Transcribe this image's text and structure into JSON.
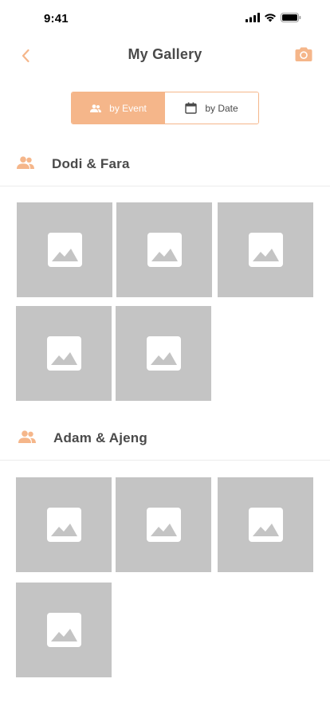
{
  "status": {
    "time": "9:41"
  },
  "header": {
    "title": "My Gallery"
  },
  "toggle": {
    "by_event_label": "by Event",
    "by_date_label": "by Date",
    "active": "by_event"
  },
  "groups": [
    {
      "name": "Dodi & Fara",
      "photo_count": 5
    },
    {
      "name": "Adam & Ajeng",
      "photo_count": 4
    }
  ],
  "colors": {
    "accent": "#f5b68a",
    "placeholder": "#c4c4c4",
    "text": "#4a4a4a"
  },
  "icons": {
    "back": "chevron-left-icon",
    "camera": "camera-icon",
    "event": "people-icon",
    "date": "calendar-icon",
    "photo": "image-icon"
  }
}
